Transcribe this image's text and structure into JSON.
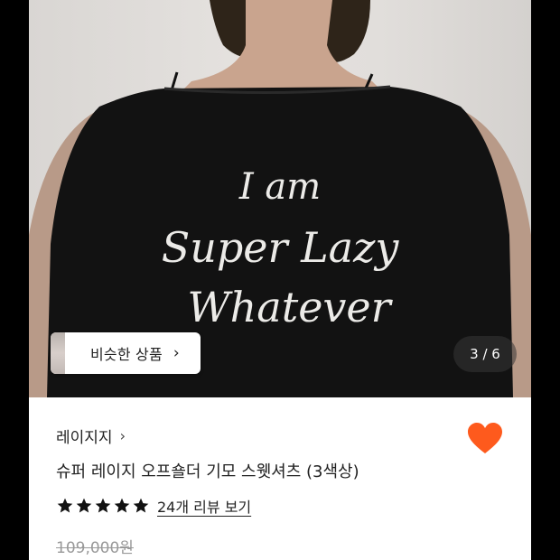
{
  "similar_products": {
    "label": "비슷한 상품",
    "chevron": "›"
  },
  "gallery": {
    "counter": "3 / 6"
  },
  "print_text": {
    "line1": "I am",
    "line2": "Super Lazy",
    "line3": "Whatever"
  },
  "product": {
    "brand": "레이지지",
    "brand_chevron": "›",
    "title": "슈퍼 레이지 오프숄더 기모 스웻셔츠 (3색상)",
    "rating_stars": 5,
    "review_link": "24개 리뷰 보기",
    "original_price": "109,000원",
    "wishlisted": true
  },
  "icons": {
    "wishlist": "heart-icon",
    "star": "star-icon",
    "chevron": "chevron-right-icon"
  },
  "colors": {
    "heart": "#fe5a1d",
    "star": "#111111",
    "text": "#222222",
    "muted": "#999999"
  }
}
